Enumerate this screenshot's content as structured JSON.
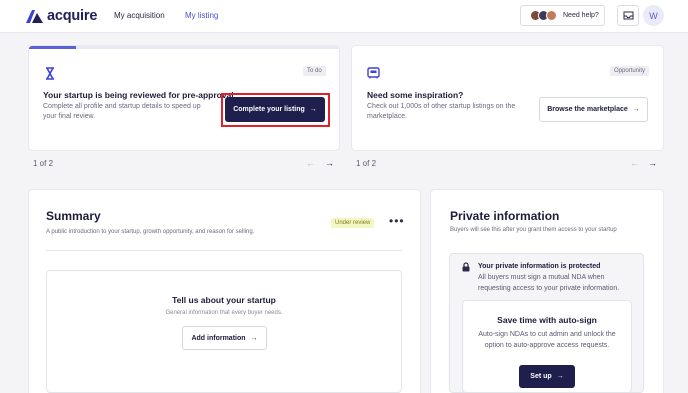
{
  "nav": {
    "brand": "acquire",
    "links": [
      "My acquisition",
      "My listing"
    ],
    "help_label": "Need help?",
    "user_initial": "W",
    "avatar_colors": [
      "#7a4a3a",
      "#3a3a5a",
      "#c27a5a"
    ]
  },
  "card1": {
    "tag": "To do",
    "title": "Your startup is being reviewed for pre-approval",
    "desc_line1": "Complete all profile and startup details to speed up",
    "desc_line2": "your final review.",
    "button": "Complete your listing",
    "pager": "1 of 2"
  },
  "card2": {
    "tag": "Opportunity",
    "title": "Need some inspiration?",
    "desc_line1": "Check out 1,000s of other startup listings on the",
    "desc_line2": "marketplace.",
    "button": "Browse the marketplace",
    "pager": "1 of 2"
  },
  "summary": {
    "title": "Summary",
    "badge": "Under review",
    "desc": "A public introduction to your startup, growth opportunity, and reason for selling.",
    "inner_title": "Tell us about your startup",
    "inner_desc": "General information that every buyer needs.",
    "button": "Add information"
  },
  "private": {
    "title": "Private information",
    "desc": "Buyers will see this after you grant them access to your startup",
    "protected_title": "Your private information is protected",
    "protected_line1": "All buyers must sign a mutual NDA when",
    "protected_line2": "requesting access to your private information.",
    "autosign_title": "Save time with auto-sign",
    "autosign_line1": "Auto-sign NDAs to cut admin and unlock the",
    "autosign_line2": "option to auto-approve access requests.",
    "button": "Set up"
  },
  "colors": {
    "accent": "#5b5fd8",
    "dark_button": "#1f1f4e",
    "highlight": "#e0202a"
  }
}
